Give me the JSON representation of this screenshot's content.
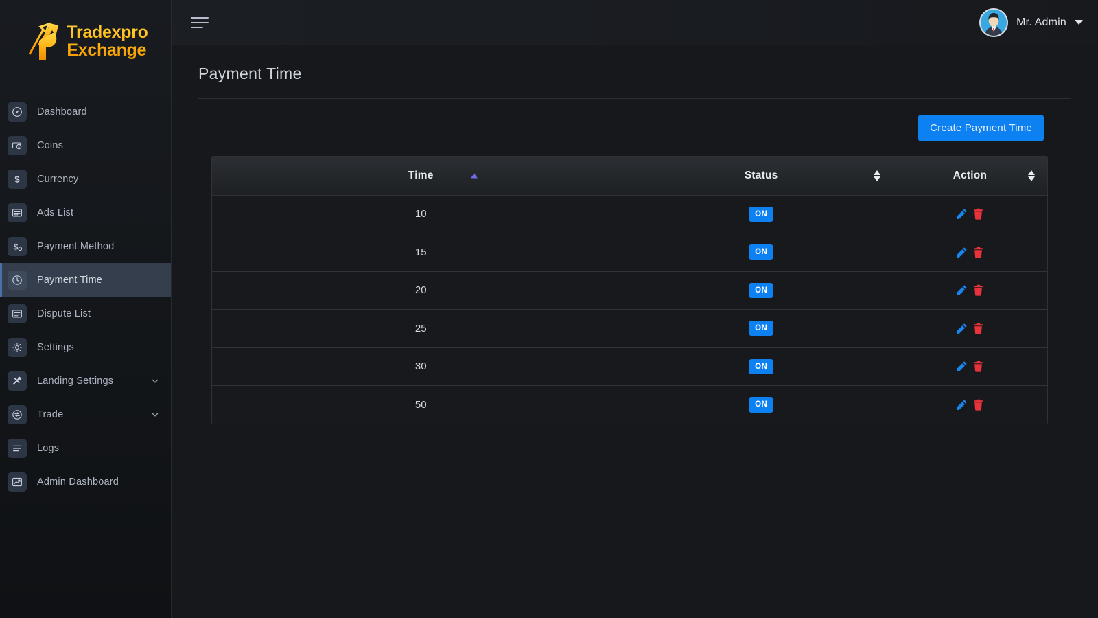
{
  "brand": {
    "line1": "Tradexpro",
    "line2": "Exchange",
    "logo_icon": "arrow-chart-logo-icon",
    "accent_color": "#ffb515"
  },
  "sidebar": {
    "items": [
      {
        "label": "Dashboard",
        "icon": "speedometer-icon",
        "active": false,
        "expandable": false
      },
      {
        "label": "Coins",
        "icon": "coin-stack-icon",
        "active": false,
        "expandable": false
      },
      {
        "label": "Currency",
        "icon": "dollar-sign-icon",
        "active": false,
        "expandable": false
      },
      {
        "label": "Ads List",
        "icon": "list-card-icon",
        "active": false,
        "expandable": false
      },
      {
        "label": "Payment Method",
        "icon": "dollar-gear-icon",
        "active": false,
        "expandable": false
      },
      {
        "label": "Payment Time",
        "icon": "clock-circle-icon",
        "active": true,
        "expandable": false
      },
      {
        "label": "Dispute List",
        "icon": "list-card-icon",
        "active": false,
        "expandable": false
      },
      {
        "label": "Settings",
        "icon": "gear-icon",
        "active": false,
        "expandable": false
      },
      {
        "label": "Landing Settings",
        "icon": "hammer-icon",
        "active": false,
        "expandable": true
      },
      {
        "label": "Trade",
        "icon": "exchange-icon",
        "active": false,
        "expandable": true
      },
      {
        "label": "Logs",
        "icon": "lines-icon",
        "active": false,
        "expandable": false
      },
      {
        "label": "Admin Dashboard",
        "icon": "trend-up-icon",
        "active": false,
        "expandable": false
      }
    ]
  },
  "topbar": {
    "menu_icon": "hamburger-icon",
    "user_name": "Mr. Admin",
    "avatar_icon": "user-avatar-icon",
    "caret_icon": "caret-down-icon"
  },
  "page": {
    "title": "Payment Time",
    "create_button": "Create Payment Time"
  },
  "table": {
    "columns": [
      {
        "label": "Time",
        "sort": "asc",
        "sort_icon": "sort-ascending-icon"
      },
      {
        "label": "Status",
        "sort": "none",
        "sort_icon": "sort-both-icon"
      },
      {
        "label": "Action",
        "sort": "none",
        "sort_icon": "sort-both-icon"
      }
    ],
    "rows": [
      {
        "time": "10",
        "status": "ON",
        "edit_icon": "pencil-icon",
        "delete_icon": "trash-icon"
      },
      {
        "time": "15",
        "status": "ON",
        "edit_icon": "pencil-icon",
        "delete_icon": "trash-icon"
      },
      {
        "time": "20",
        "status": "ON",
        "edit_icon": "pencil-icon",
        "delete_icon": "trash-icon"
      },
      {
        "time": "25",
        "status": "ON",
        "edit_icon": "pencil-icon",
        "delete_icon": "trash-icon"
      },
      {
        "time": "30",
        "status": "ON",
        "edit_icon": "pencil-icon",
        "delete_icon": "trash-icon"
      },
      {
        "time": "50",
        "status": "ON",
        "edit_icon": "pencil-icon",
        "delete_icon": "trash-icon"
      }
    ]
  },
  "colors": {
    "primary": "#0d81f2",
    "danger": "#e8333a",
    "edit": "#1785ec",
    "sidebar_active": "#353e4c",
    "sort_active": "#6c6ced"
  }
}
